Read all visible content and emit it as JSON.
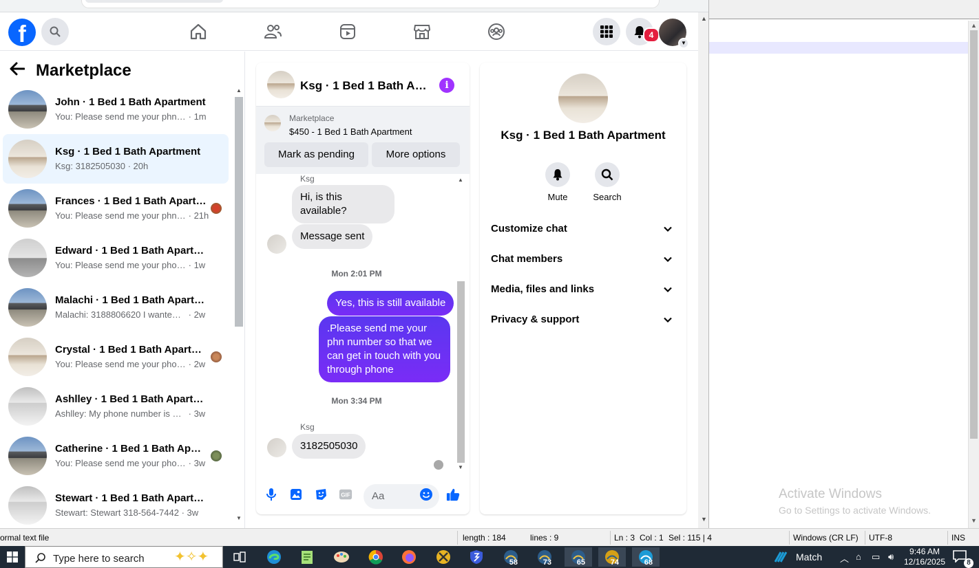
{
  "marketplace": {
    "title": "Marketplace",
    "conversations": [
      {
        "title": "John · 1 Bed 1 Bath Apartment",
        "snippet": "You: Please send me your phn nu...",
        "time": "· 1m",
        "thumb": "house"
      },
      {
        "title": "Ksg · 1 Bed 1 Bath Apartment",
        "snippet": "Ksg: 3182505030",
        "time": "· 20h",
        "thumb": "room"
      },
      {
        "title": "Frances · 1 Bed 1 Bath Apartm...",
        "snippet": "You: Please send me your phn ...",
        "time": "· 21h",
        "thumb": "house"
      },
      {
        "title": "Edward · 1 Bed 1 Bath Apartment",
        "snippet": "You: Please send me your phone n...",
        "time": "· 1w",
        "thumb": "empty"
      },
      {
        "title": "Malachi · 1 Bed 1 Bath Apartment",
        "snippet": "Malachi: 3188806620 I wanted a t...",
        "time": "· 2w",
        "thumb": "house"
      },
      {
        "title": "Crystal · 1 Bed 1 Bath Apartm...",
        "snippet": "You: Please send me your phon...",
        "time": "· 2w",
        "thumb": "room"
      },
      {
        "title": "Ashlley · 1 Bed 1 Bath Apartment",
        "snippet": "Ashlley: My phone number is 9168...",
        "time": "· 3w",
        "thumb": "bath"
      },
      {
        "title": "Catherine · 1 Bed 1 Bath Apart...",
        "snippet": "You: Please send me your phon...",
        "time": "· 3w",
        "thumb": "house"
      },
      {
        "title": "Stewart · 1 Bed 1 Bath Apartment",
        "snippet": "Stewart: Stewart 318-564-7442",
        "time": "· 3w",
        "thumb": "bath"
      }
    ]
  },
  "nav": {
    "notification_count": "4"
  },
  "chat": {
    "header_name": "Ksg · 1 Bed 1 Bath Apa...",
    "listing_source": "Marketplace",
    "listing_title": "$450 - 1 Bed 1 Bath Apartment",
    "mark_pending": "Mark as pending",
    "more_options": "More options",
    "sender": "Ksg",
    "msg1": "Hi, is this available?",
    "msg2": "Message sent",
    "time1": "Mon 2:01 PM",
    "out1": "Yes, this is still available",
    "out2": ".Please send me your phn number so that we can get in touch with you through phone",
    "time2": "Mon 3:34 PM",
    "msg3": "3182505030",
    "input_placeholder": "Aa"
  },
  "info": {
    "name": "Ksg · 1 Bed 1 Bath Apartment",
    "mute": "Mute",
    "search": "Search",
    "sections": [
      "Customize chat",
      "Chat members",
      "Media, files and links",
      "Privacy & support"
    ]
  },
  "editor": {
    "activate_title": "Activate Windows",
    "activate_sub": "Go to Settings to activate Windows."
  },
  "statusbar": {
    "file_type": "ormal text file",
    "length": "length : 184",
    "lines": "lines : 9",
    "ln": "Ln : 3",
    "col": "Col : 1",
    "sel": "Sel : 115 | 4",
    "eol": "Windows (CR LF)",
    "encoding": "UTF-8",
    "mode": "INS"
  },
  "taskbar": {
    "search_placeholder": "Type here to search",
    "badge_58": "58",
    "badge_73": "73",
    "badge_65": "65",
    "badge_74": "74",
    "badge_68": "68",
    "weather": "Match",
    "time": "9:46 AM",
    "date": "12/16/2025",
    "notif_count": "8"
  },
  "colors": {
    "fb_blue": "#0866ff",
    "messenger_purple": "#6b2ff6",
    "active_row": "#ebf5ff",
    "badge_red": "#e41e3f"
  }
}
